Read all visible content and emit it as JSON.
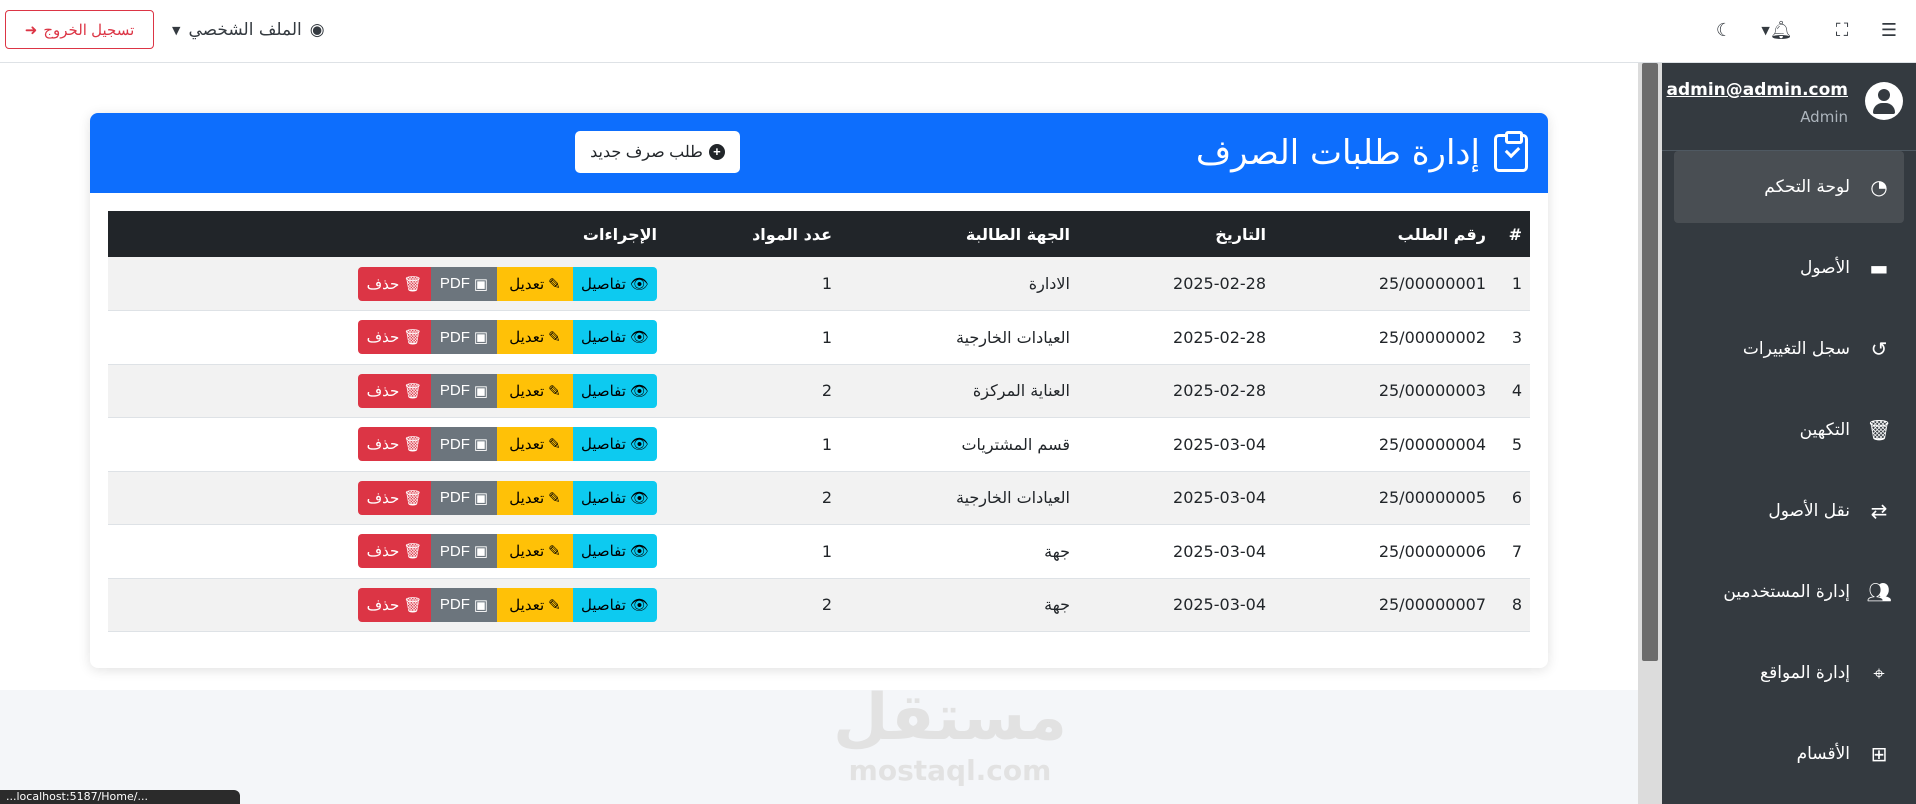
{
  "navbar": {
    "logout_label": "تسجيل الخروج",
    "profile_label": "الملف الشخصي",
    "icons": [
      "menu-icon",
      "fullscreen-icon",
      "bell-icon",
      "moon-icon",
      "user-circle-icon",
      "sign-out-icon"
    ]
  },
  "card": {
    "title": "إدارة طلبات الصرف",
    "new_button": "طلب صرف جديد",
    "header_color": "#0d6efd"
  },
  "table": {
    "headers": [
      "#",
      "رقم الطلب",
      "التاريخ",
      "الجهة الطالبة",
      "عدد المواد",
      "الإجراءات"
    ],
    "rows": [
      {
        "num": "1",
        "id": "25/00000001",
        "date": "2025-02-28",
        "dept": "الادارة",
        "count": "1"
      },
      {
        "num": "3",
        "id": "25/00000002",
        "date": "2025-02-28",
        "dept": "العيادات الخارجية",
        "count": "1"
      },
      {
        "num": "4",
        "id": "25/00000003",
        "date": "2025-02-28",
        "dept": "العناية المركزة",
        "count": "2"
      },
      {
        "num": "5",
        "id": "25/00000004",
        "date": "2025-03-04",
        "dept": "قسم المشتريات",
        "count": "1"
      },
      {
        "num": "6",
        "id": "25/00000005",
        "date": "2025-03-04",
        "dept": "العيادات الخارجية",
        "count": "2"
      },
      {
        "num": "7",
        "id": "25/00000006",
        "date": "2025-03-04",
        "dept": "جهة",
        "count": "1"
      },
      {
        "num": "8",
        "id": "25/00000007",
        "date": "2025-03-04",
        "dept": "جهة",
        "count": "2"
      }
    ],
    "actions": {
      "details": "تفاصيل",
      "edit": "تعديل",
      "pdf": "PDF",
      "delete": "حذف"
    }
  },
  "sidebar": {
    "email": "admin@admin.com",
    "role": "Admin",
    "items": [
      {
        "label": "لوحة التحكم",
        "icon": "tachometer-icon",
        "active": true
      },
      {
        "label": "الأصول",
        "icon": "box-icon"
      },
      {
        "label": "سجل التغييرات",
        "icon": "history-icon"
      },
      {
        "label": "التكهين",
        "icon": "trash-icon"
      },
      {
        "label": "نقل الأصول",
        "icon": "exchange-icon"
      },
      {
        "label": "إدارة المستخدمين",
        "icon": "users-icon"
      },
      {
        "label": "إدارة المواقع",
        "icon": "map-icon"
      },
      {
        "label": "الأقسام",
        "icon": "sitemap-icon"
      }
    ]
  },
  "watermark": {
    "arabic": "مستقل",
    "english": "mostaql.com"
  },
  "statusbar": {
    "text": "...localhost:5187/Home/..."
  }
}
